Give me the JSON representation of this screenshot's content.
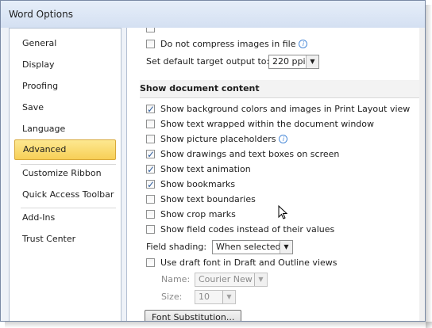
{
  "window": {
    "title": "Word Options"
  },
  "sidebar": {
    "items": [
      {
        "label": "General",
        "active": false
      },
      {
        "label": "Display",
        "active": false
      },
      {
        "label": "Proofing",
        "active": false
      },
      {
        "label": "Save",
        "active": false
      },
      {
        "label": "Language",
        "active": false
      },
      {
        "label": "Advanced",
        "active": true
      },
      {
        "label": "Customize Ribbon",
        "active": false
      },
      {
        "label": "Quick Access Toolbar",
        "active": false
      },
      {
        "label": "Add-Ins",
        "active": false
      },
      {
        "label": "Trust Center",
        "active": false
      }
    ]
  },
  "content": {
    "compress_images": {
      "label": "Do not compress images in file",
      "checked": false
    },
    "default_target": {
      "label": "Set default target output to:",
      "value": "220 ppi"
    },
    "section_title": "Show document content",
    "options": [
      {
        "label": "Show background colors and images in Print Layout view",
        "checked": true
      },
      {
        "label": "Show text wrapped within the document window",
        "checked": false
      },
      {
        "label": "Show picture placeholders",
        "checked": false
      },
      {
        "label": "Show drawings and text boxes on screen",
        "checked": true
      },
      {
        "label": "Show text animation",
        "checked": true
      },
      {
        "label": "Show bookmarks",
        "checked": true
      },
      {
        "label": "Show text boundaries",
        "checked": false
      },
      {
        "label": "Show crop marks",
        "checked": false
      },
      {
        "label": "Show field codes instead of their values",
        "checked": false
      }
    ],
    "field_shading": {
      "label": "Field shading:",
      "value": "When selected"
    },
    "draft_font": {
      "label": "Use draft font in Draft and Outline views",
      "checked": false
    },
    "font_name": {
      "label": "Name:",
      "value": "Courier New"
    },
    "font_size": {
      "label": "Size:",
      "value": "10"
    },
    "font_substitution_button": "Font Substitution..."
  },
  "icons": {
    "info": "info-icon",
    "dropdown": "chevron-down-icon",
    "check": "checkmark-icon",
    "cursor": "mouse-pointer-icon"
  }
}
